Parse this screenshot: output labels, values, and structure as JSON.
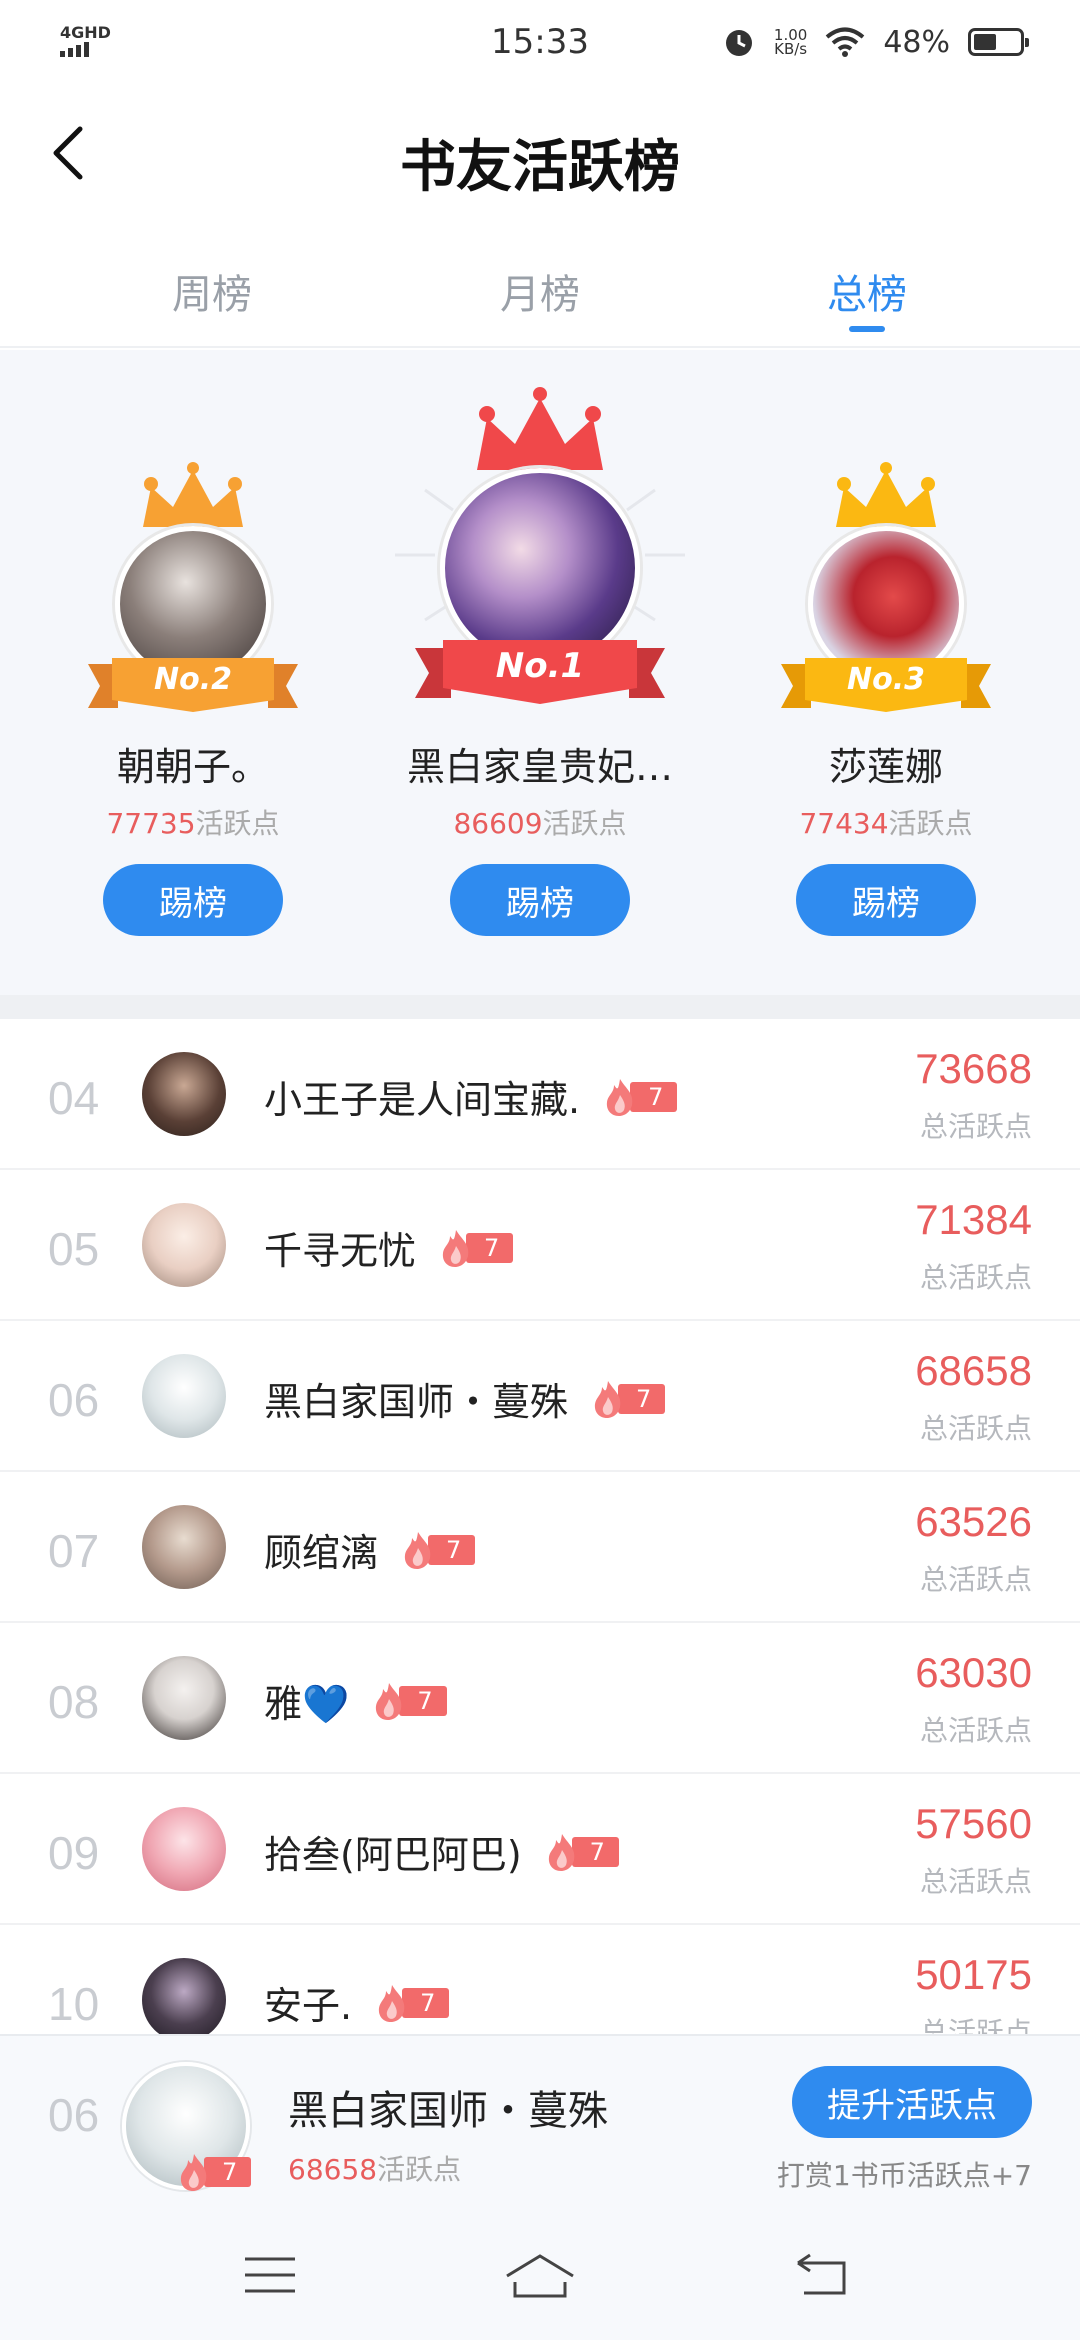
{
  "statusbar": {
    "network": "4GHD",
    "time": "15:33",
    "speed_value": "1.00",
    "speed_unit": "KB/s",
    "battery": "48%"
  },
  "header": {
    "title": "书友活跃榜"
  },
  "tabs": [
    {
      "label": "周榜"
    },
    {
      "label": "月榜"
    },
    {
      "label": "总榜",
      "active": true
    }
  ],
  "podium": [
    {
      "rank_label": "No.2",
      "name": "朝朝子。",
      "points": "77735",
      "points_suffix": "活跃点",
      "button": "踢榜",
      "crown_color": "#f7a133"
    },
    {
      "rank_label": "No.1",
      "name": "黑白家皇贵妃…",
      "points": "86609",
      "points_suffix": "活跃点",
      "button": "踢榜",
      "crown_color": "#f0484a"
    },
    {
      "rank_label": "No.3",
      "name": "莎莲娜",
      "points": "77434",
      "points_suffix": "活跃点",
      "button": "踢榜",
      "crown_color": "#fbb812"
    }
  ],
  "list": [
    {
      "rank": "04",
      "name": "小王子是人间宝藏.",
      "level": "7",
      "score": "73668",
      "label": "总活跃点",
      "avatar_color": "#5a4036"
    },
    {
      "rank": "05",
      "name": "千寻无忧",
      "level": "7",
      "score": "71384",
      "label": "总活跃点",
      "avatar_color": "#e9cfc3"
    },
    {
      "rank": "06",
      "name": "黑白家国师・蔓殊",
      "level": "7",
      "score": "68658",
      "label": "总活跃点",
      "avatar_color": "#dfe6e8"
    },
    {
      "rank": "07",
      "name": "顾绾漓",
      "level": "7",
      "score": "63526",
      "label": "总活跃点",
      "avatar_color": "#b49a8c"
    },
    {
      "rank": "08",
      "name": "雅💙",
      "level": "7",
      "score": "63030",
      "label": "总活跃点",
      "avatar_color": "#d7d2cf"
    },
    {
      "rank": "09",
      "name": "拾叁(阿巴阿巴)",
      "level": "7",
      "score": "57560",
      "label": "总活跃点",
      "avatar_color": "#f0a7b3"
    },
    {
      "rank": "10",
      "name": "安子.",
      "level": "7",
      "score": "50175",
      "label": "总活跃点",
      "avatar_color": "#4b3f4f"
    }
  ],
  "me": {
    "rank": "06",
    "name": "黑白家国师・蔓殊",
    "level": "7",
    "points": "68658",
    "points_suffix": "活跃点",
    "button": "提升活跃点",
    "hint": "打赏1书币活跃点+7"
  },
  "colors": {
    "accent": "#2f8bef",
    "score": "#e85d5d",
    "badge": "#f26a6a"
  }
}
